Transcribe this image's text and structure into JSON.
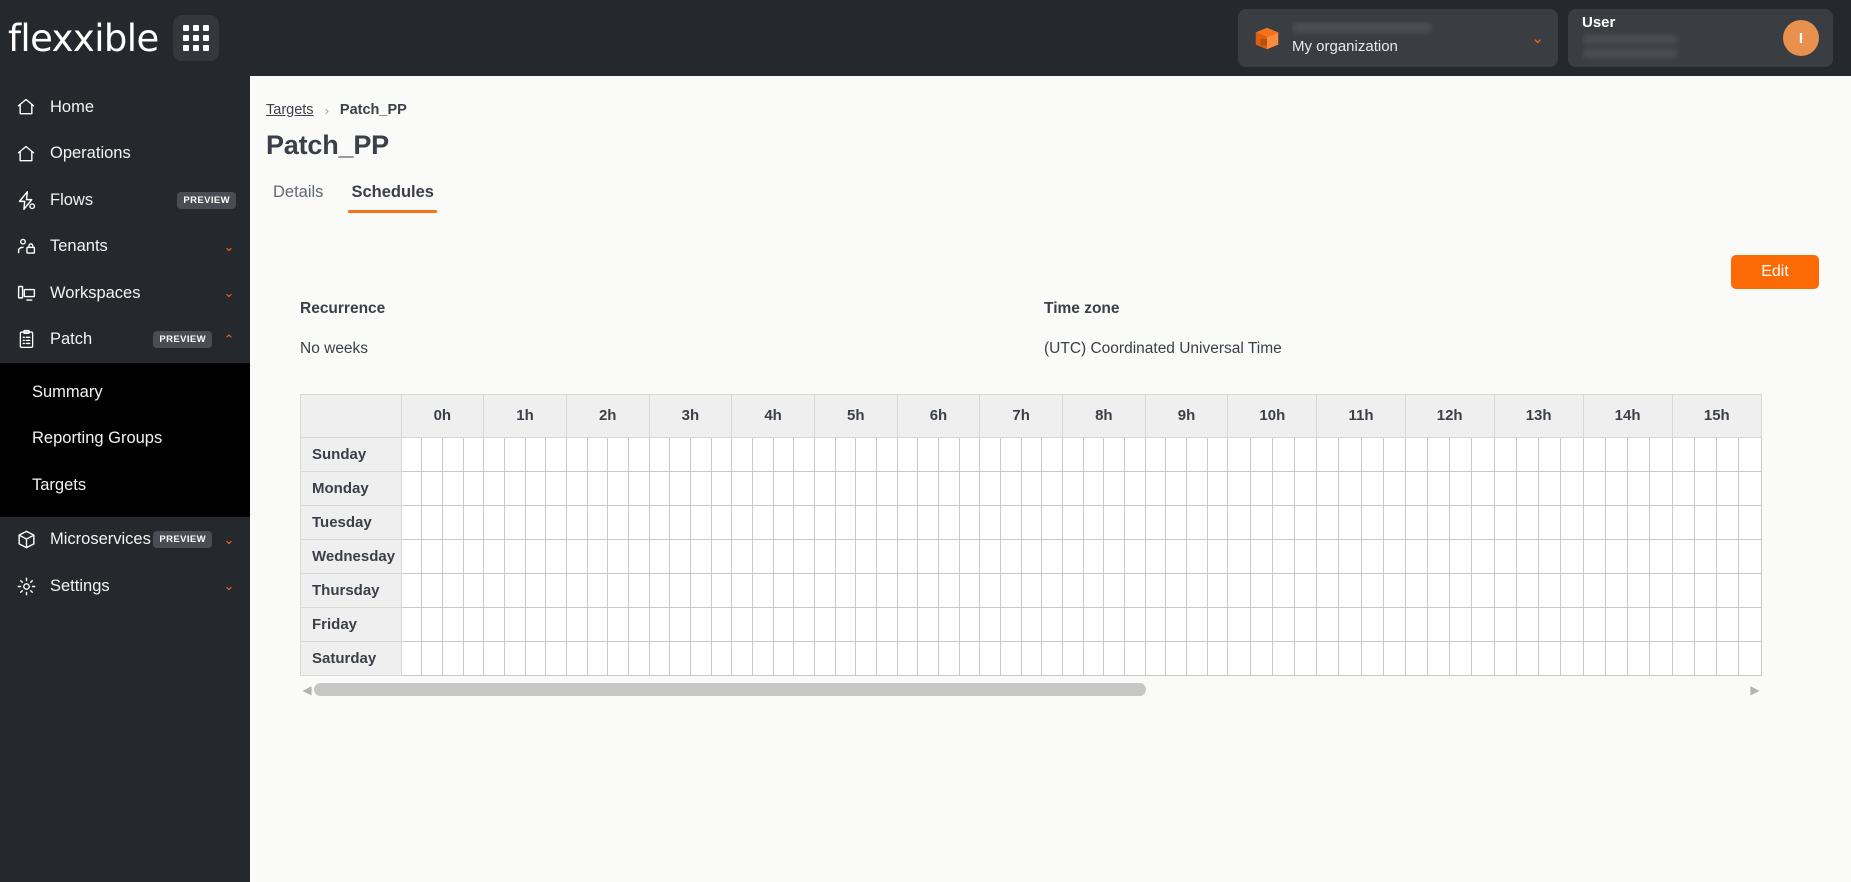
{
  "brand": {
    "logo_text": "flexxible",
    "accent": "#f4721c",
    "button_orange": "#fb6a05"
  },
  "topbar": {
    "apps_label": "apps-grid",
    "organization": {
      "name": "My organization",
      "chevron": "⌄"
    },
    "user": {
      "label": "User",
      "avatar_initial": "I"
    }
  },
  "sidebar": {
    "items": [
      {
        "label": "Home",
        "icon": "home-icon",
        "badge": "",
        "chevron": ""
      },
      {
        "label": "Operations",
        "icon": "home-icon",
        "badge": "",
        "chevron": ""
      },
      {
        "label": "Flows",
        "icon": "flows-icon",
        "badge": "PREVIEW",
        "chevron": ""
      },
      {
        "label": "Tenants",
        "icon": "tenants-icon",
        "badge": "",
        "chevron": "⌄"
      },
      {
        "label": "Workspaces",
        "icon": "workspaces-icon",
        "badge": "",
        "chevron": "⌄"
      },
      {
        "label": "Patch",
        "icon": "patch-icon",
        "badge": "PREVIEW",
        "chevron": "⌃"
      }
    ],
    "patch_subitems": [
      {
        "label": "Summary"
      },
      {
        "label": "Reporting Groups"
      },
      {
        "label": "Targets"
      }
    ],
    "bottom_items": [
      {
        "label": "Microservices",
        "icon": "cube-icon",
        "badge": "PREVIEW",
        "chevron": "⌄"
      },
      {
        "label": "Settings",
        "icon": "gear-icon",
        "badge": "",
        "chevron": "⌄"
      }
    ]
  },
  "main": {
    "breadcrumb": {
      "parent": "Targets",
      "separator": "›",
      "current": "Patch_PP"
    },
    "page_title": "Patch_PP",
    "tabs": [
      {
        "label": "Details",
        "active": false
      },
      {
        "label": "Schedules",
        "active": true
      }
    ],
    "edit_button": "Edit",
    "fields": [
      {
        "label": "Recurrence",
        "value": "No weeks"
      },
      {
        "label": "Time zone",
        "value": "(UTC) Coordinated Universal Time"
      }
    ]
  },
  "schedule": {
    "hours": [
      "0h",
      "1h",
      "2h",
      "3h",
      "4h",
      "5h",
      "6h",
      "7h",
      "8h",
      "9h",
      "10h",
      "11h",
      "12h",
      "13h",
      "14h",
      "15h"
    ],
    "slots_per_hour": 4,
    "days": [
      "Sunday",
      "Monday",
      "Tuesday",
      "Wednesday",
      "Thursday",
      "Friday",
      "Saturday"
    ],
    "selected_slots": [],
    "scrollbar": {
      "left_arrow": "◀",
      "right_arrow": "▶",
      "thumb_percent": 58
    }
  }
}
